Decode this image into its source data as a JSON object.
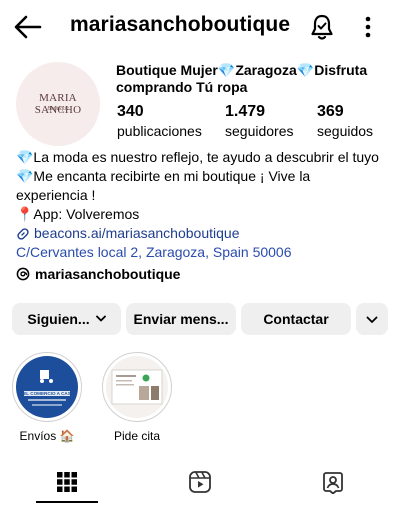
{
  "header": {
    "username": "mariasanchoboutique",
    "back_icon": "arrow-left-icon",
    "bell_icon": "bell-icon",
    "more_icon": "more-vertical-icon"
  },
  "profile": {
    "avatar_logo_text": "MARIA SANCHO",
    "avatar_logo_sub": "Boutique",
    "display_name": "Boutique Mujer💎Zaragoza💎Disfruta comprando Tú ropa",
    "stats": [
      {
        "value": "340",
        "label": "publicaciones"
      },
      {
        "value": "1.479",
        "label": "seguidores"
      },
      {
        "value": "369",
        "label": "seguidos"
      }
    ]
  },
  "bio": {
    "line1": "💎La moda es nuestro reflejo, te ayudo a descubrir el tuyo",
    "line2": "💎Me encanta recibirte en mi boutique ¡ Vive la",
    "line3": "experiencia !",
    "line4": "📍App: Volveremos",
    "link": "beacons.ai/mariasanchoboutique",
    "address": "C/Cervantes local 2, Zaragoza, Spain 50006",
    "threads_handle": "mariasanchoboutique"
  },
  "actions": {
    "follow": "Siguien...",
    "message": "Enviar mens...",
    "contact": "Contactar"
  },
  "highlights": [
    {
      "label": "Envíos 🏠",
      "inner_title": "DEL COMERCIO A CASA"
    },
    {
      "label": "Pide cita"
    }
  ],
  "tabs": [
    "grid-icon",
    "reels-icon",
    "tagged-icon"
  ],
  "colors": {
    "link": "#1e3d8f",
    "button_bg": "#efefef",
    "highlight1_bg": "#1d4e9c"
  }
}
